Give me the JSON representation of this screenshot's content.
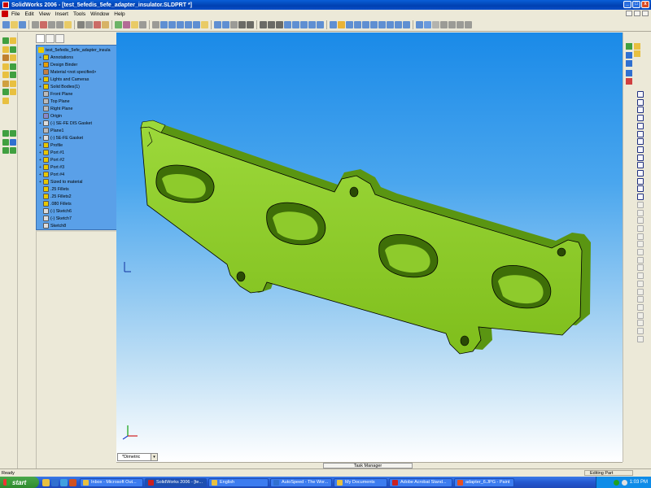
{
  "window": {
    "title": "SolidWorks 2006 - [test_5efedis_5efe_adapter_insulator.SLDPRT *]",
    "controls": [
      "_",
      "□",
      "x"
    ]
  },
  "menu": {
    "items": [
      "File",
      "Edit",
      "View",
      "Insert",
      "Tools",
      "Window",
      "Help"
    ]
  },
  "tree": {
    "root": "test_5efedis_5efe_adapter_insula",
    "items": [
      {
        "label": "Annotations",
        "expand": "+",
        "icon_color": "#e8c800"
      },
      {
        "label": "Design Binder",
        "expand": "+",
        "icon_color": "#e8a000"
      },
      {
        "label": "Material <not specified>",
        "expand": "",
        "icon_color": "#c88040"
      },
      {
        "label": "Lights and Cameras",
        "expand": "+",
        "icon_color": "#e8c800"
      },
      {
        "label": "Solid Bodies(1)",
        "expand": "+",
        "icon_color": "#e8c800"
      },
      {
        "label": "Front Plane",
        "expand": "",
        "icon_color": "#bbbbbb"
      },
      {
        "label": "Top Plane",
        "expand": "",
        "icon_color": "#bbbbbb"
      },
      {
        "label": "Right Plane",
        "expand": "",
        "icon_color": "#bbbbbb"
      },
      {
        "label": "Origin",
        "expand": "",
        "icon_color": "#8888cc"
      },
      {
        "label": "(-) SE-FE DIS Gasket",
        "expand": "+",
        "icon_color": "#dddddd"
      },
      {
        "label": "Plane1",
        "expand": "",
        "icon_color": "#bbbbbb"
      },
      {
        "label": "(-) 5E-FE Gasket",
        "expand": "+",
        "icon_color": "#dddddd"
      },
      {
        "label": "Profile",
        "expand": "+",
        "icon_color": "#e8c800"
      },
      {
        "label": "Port #1",
        "expand": "+",
        "icon_color": "#e8c800"
      },
      {
        "label": "Port #2",
        "expand": "+",
        "icon_color": "#e8c800"
      },
      {
        "label": "Port #3",
        "expand": "+",
        "icon_color": "#e8c800"
      },
      {
        "label": "Port #4",
        "expand": "+",
        "icon_color": "#e8c800"
      },
      {
        "label": "Sized to material",
        "expand": "+",
        "icon_color": "#e8c800"
      },
      {
        "label": ".25 Fillets",
        "expand": "",
        "icon_color": "#e8c800"
      },
      {
        "label": ".25 Fillets2",
        "expand": "",
        "icon_color": "#e8c800"
      },
      {
        "label": ".080 Fillets",
        "expand": "",
        "icon_color": "#e8c800"
      },
      {
        "label": "(-) Sketch6",
        "expand": "",
        "icon_color": "#dddddd"
      },
      {
        "label": "(-) Sketch7",
        "expand": "",
        "icon_color": "#dddddd"
      },
      {
        "label": "Sketch8",
        "expand": "",
        "icon_color": "#dddddd"
      }
    ]
  },
  "viewport": {
    "view_orientation": "*Dimetric",
    "part_color": "#7fc21a"
  },
  "task_manager": {
    "label": "Task Manager"
  },
  "status": {
    "left": "Ready",
    "mode": "Editing Part"
  },
  "taskbar": {
    "start": "start",
    "buttons": [
      {
        "label": "Inbox - Microsoft Out...",
        "icon_color": "#e8c040",
        "active": false
      },
      {
        "label": "SolidWorks 2006 - [te...",
        "icon_color": "#cc2020",
        "active": true
      },
      {
        "label": "English",
        "icon_color": "#e8c040",
        "active": false
      },
      {
        "label": "AutoSpeed - The Wor...",
        "icon_color": "#3070d0",
        "active": false
      },
      {
        "label": "My Documents",
        "icon_color": "#e8c040",
        "active": false
      },
      {
        "label": "Adobe Acrobat Stand...",
        "icon_color": "#cc2020",
        "active": false
      },
      {
        "label": "adapter_6.JPG - Paint",
        "icon_color": "#e85020",
        "active": false
      }
    ],
    "clock": "1:03 PM"
  }
}
